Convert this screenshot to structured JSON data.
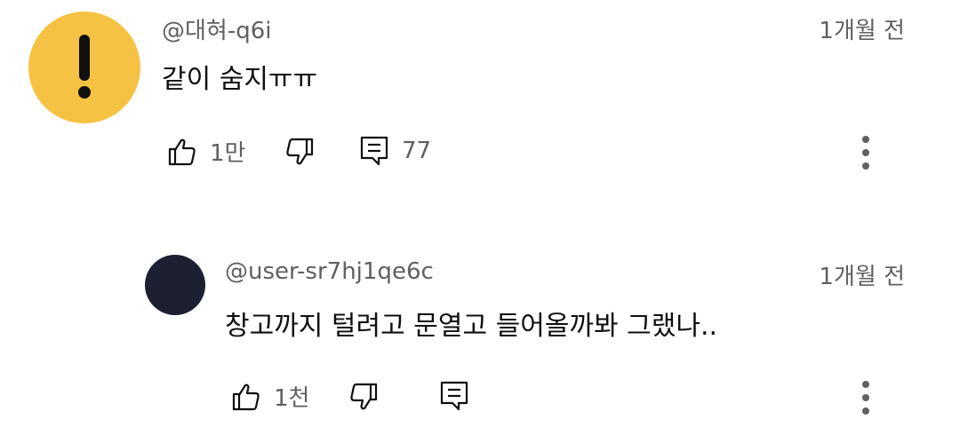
{
  "comments": [
    {
      "author": "@대혀-q6i",
      "time": "1개월 전",
      "text": "같이 숨지ㅠㅠ",
      "avatar_color": "#f6c244",
      "avatar_icon": "exclamation-icon",
      "likes": "1만",
      "replies": "77"
    },
    {
      "author": "@user-sr7hj1qe6c",
      "time": "1개월 전",
      "text": "창고까지 털려고 문열고 들어올까봐 그랬나..",
      "avatar_color": "#1c2030",
      "likes": "1천"
    }
  ]
}
